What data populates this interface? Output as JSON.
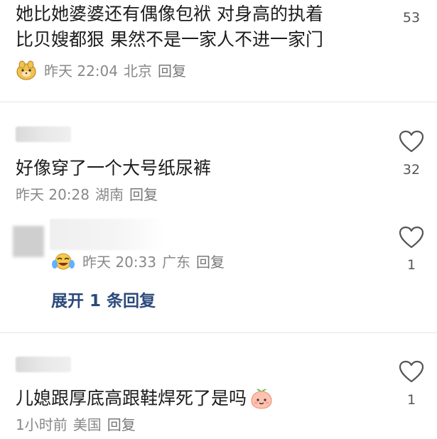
{
  "comments": [
    {
      "line1": "她比她婆婆还有偶像包袱 对身高的执着",
      "line2": "比贝嫂都狠 果然不是一家人不进一家门",
      "time": "昨天 22:04",
      "location": "北京",
      "reply": "回复",
      "likes": "53"
    },
    {
      "text": "好像穿了一个大号纸尿裤",
      "time": "昨天 20:28",
      "location": "湖南",
      "reply": "回复",
      "likes": "32"
    },
    {
      "time": "昨天 20:33",
      "location": "广东",
      "reply": "回复",
      "likes": "1",
      "expand": "展开 1 条回复"
    },
    {
      "text": "儿媳跟厚底高跟鞋焊死了是吗",
      "time": "1小时前",
      "location": "美国",
      "reply": "回复",
      "likes": "1"
    }
  ],
  "icons": {
    "like": "heart-outline-icon",
    "avatar_emoji": "peach-face-icon",
    "crying_emoji": "crying-laugh-icon"
  }
}
